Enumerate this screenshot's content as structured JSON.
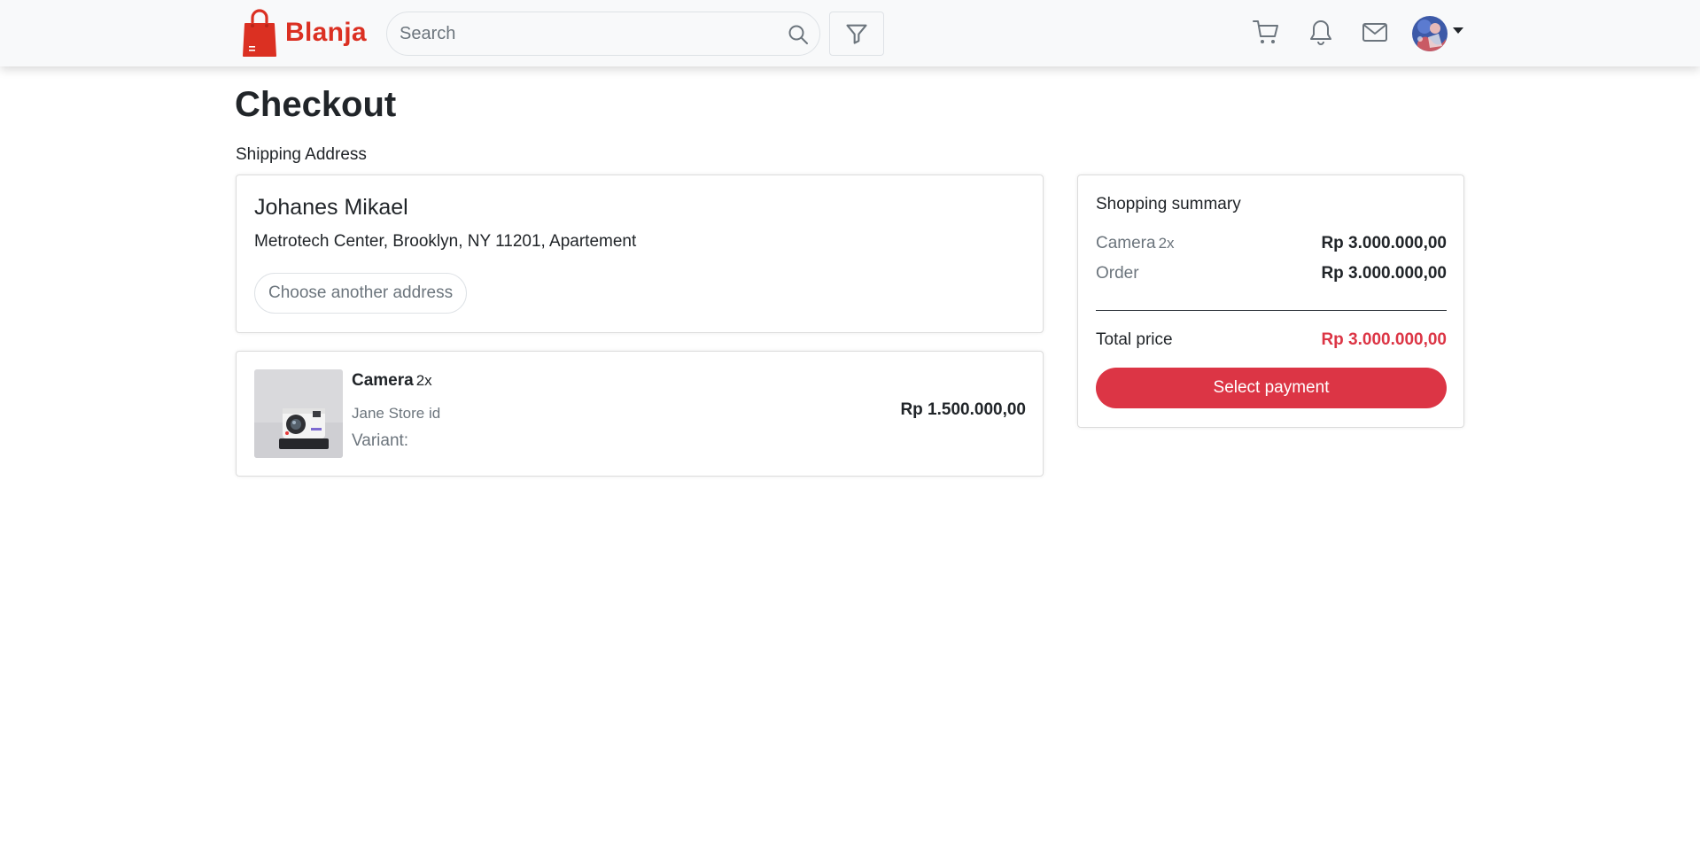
{
  "navbar": {
    "brand_name": "Blanja",
    "brand_color": "#db3022",
    "search": {
      "placeholder": "Search",
      "value": ""
    },
    "icons": [
      "logo-bag-icon",
      "search-icon",
      "filter-icon",
      "cart-icon",
      "bell-icon",
      "mail-icon",
      "avatar",
      "caret-down-icon"
    ]
  },
  "page": {
    "title": "Checkout",
    "shipping_label": "Shipping Address"
  },
  "address": {
    "name": "Johanes Mikael",
    "line": "Metrotech Center, Brooklyn, NY 11201, Apartement",
    "choose_button": "Choose another address"
  },
  "product": {
    "name": "Camera",
    "quantity": "2x",
    "store": "Jane Store id",
    "variant": "Variant:",
    "price": "Rp 1.500.000,00"
  },
  "summary": {
    "title": "Shopping summary",
    "items": [
      {
        "label": "Camera",
        "qty": "2x",
        "value": "Rp 3.000.000,00"
      },
      {
        "label": "Order",
        "qty": "",
        "value": "Rp 3.000.000,00"
      }
    ],
    "total_label": "Total price",
    "total_value": "Rp 3.000.000,00",
    "pay_button": "Select payment",
    "accent_color": "#dc3545"
  }
}
